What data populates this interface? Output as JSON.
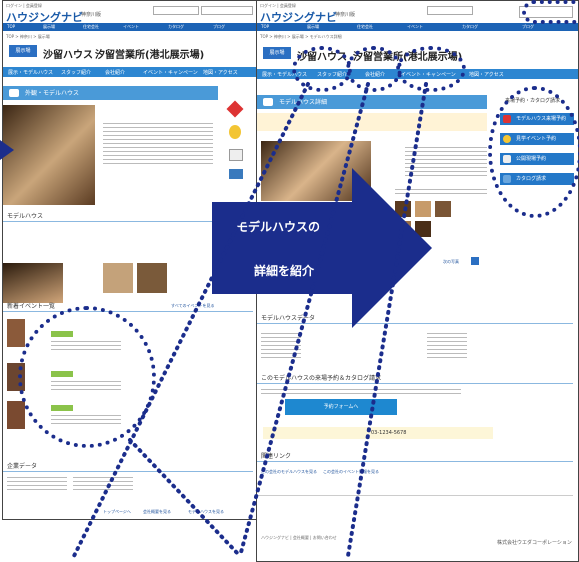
{
  "left_page": {
    "logo": "ハウジングナビ",
    "region": "神奈川版",
    "badge": "展示場",
    "company": "沙留ハウス",
    "exhibition": "汐留営業所(港北展示場)",
    "tabs": [
      "展示・モデルハウス",
      "スタッフ紹介",
      "会社紹介",
      "イベント・キャンペーン",
      "地図・アクセス"
    ],
    "section_title": "外観・モデルハウス",
    "model_house_heading": "モデルハウス",
    "event_heading": "新着イベント一覧",
    "event_link": "すべてのイベントを見る",
    "company_data_heading": "企業データ",
    "footer_links": [
      "トップページへ",
      "会社概要を見る",
      "モデルハウスを見る"
    ]
  },
  "right_page": {
    "logo": "ハウジングナビ",
    "region": "神奈川版",
    "badge": "展示場",
    "company": "沙留ハウス",
    "exhibition": "汐留営業所(港北展示場)",
    "tabs": [
      "展示・モデルハウス",
      "スタッフ紹介",
      "会社紹介",
      "イベント・キャンペーン",
      "地図・アクセス"
    ],
    "section_title": "モデルハウス詳細",
    "side_heading": "来場予約・カタログ請求",
    "side_buttons": [
      "モデルハウス来場予約",
      "見学イベント予約",
      "公開現場予約",
      "カタログ請求"
    ],
    "next_link": "次の写真",
    "data_heading": "モデルハウスデータ",
    "reserve_heading": "このモデルハウスの来場予約＆カタログ請求",
    "reserve_button": "予約フォームへ",
    "phone": "03-1234-5678",
    "related_heading": "関連リンク",
    "related_items": [
      "この会社のモデルハウスを見る",
      "この会社のイベント情報を見る"
    ],
    "footer_company": "株式会社ウエダコーポレーション"
  },
  "callout": {
    "line1": "モデルハウスの",
    "line2": "詳細を紹介"
  },
  "colors": {
    "navy": "#1b2d8c",
    "brand_blue": "#1c63b5",
    "tab_blue": "#2d86d1"
  }
}
